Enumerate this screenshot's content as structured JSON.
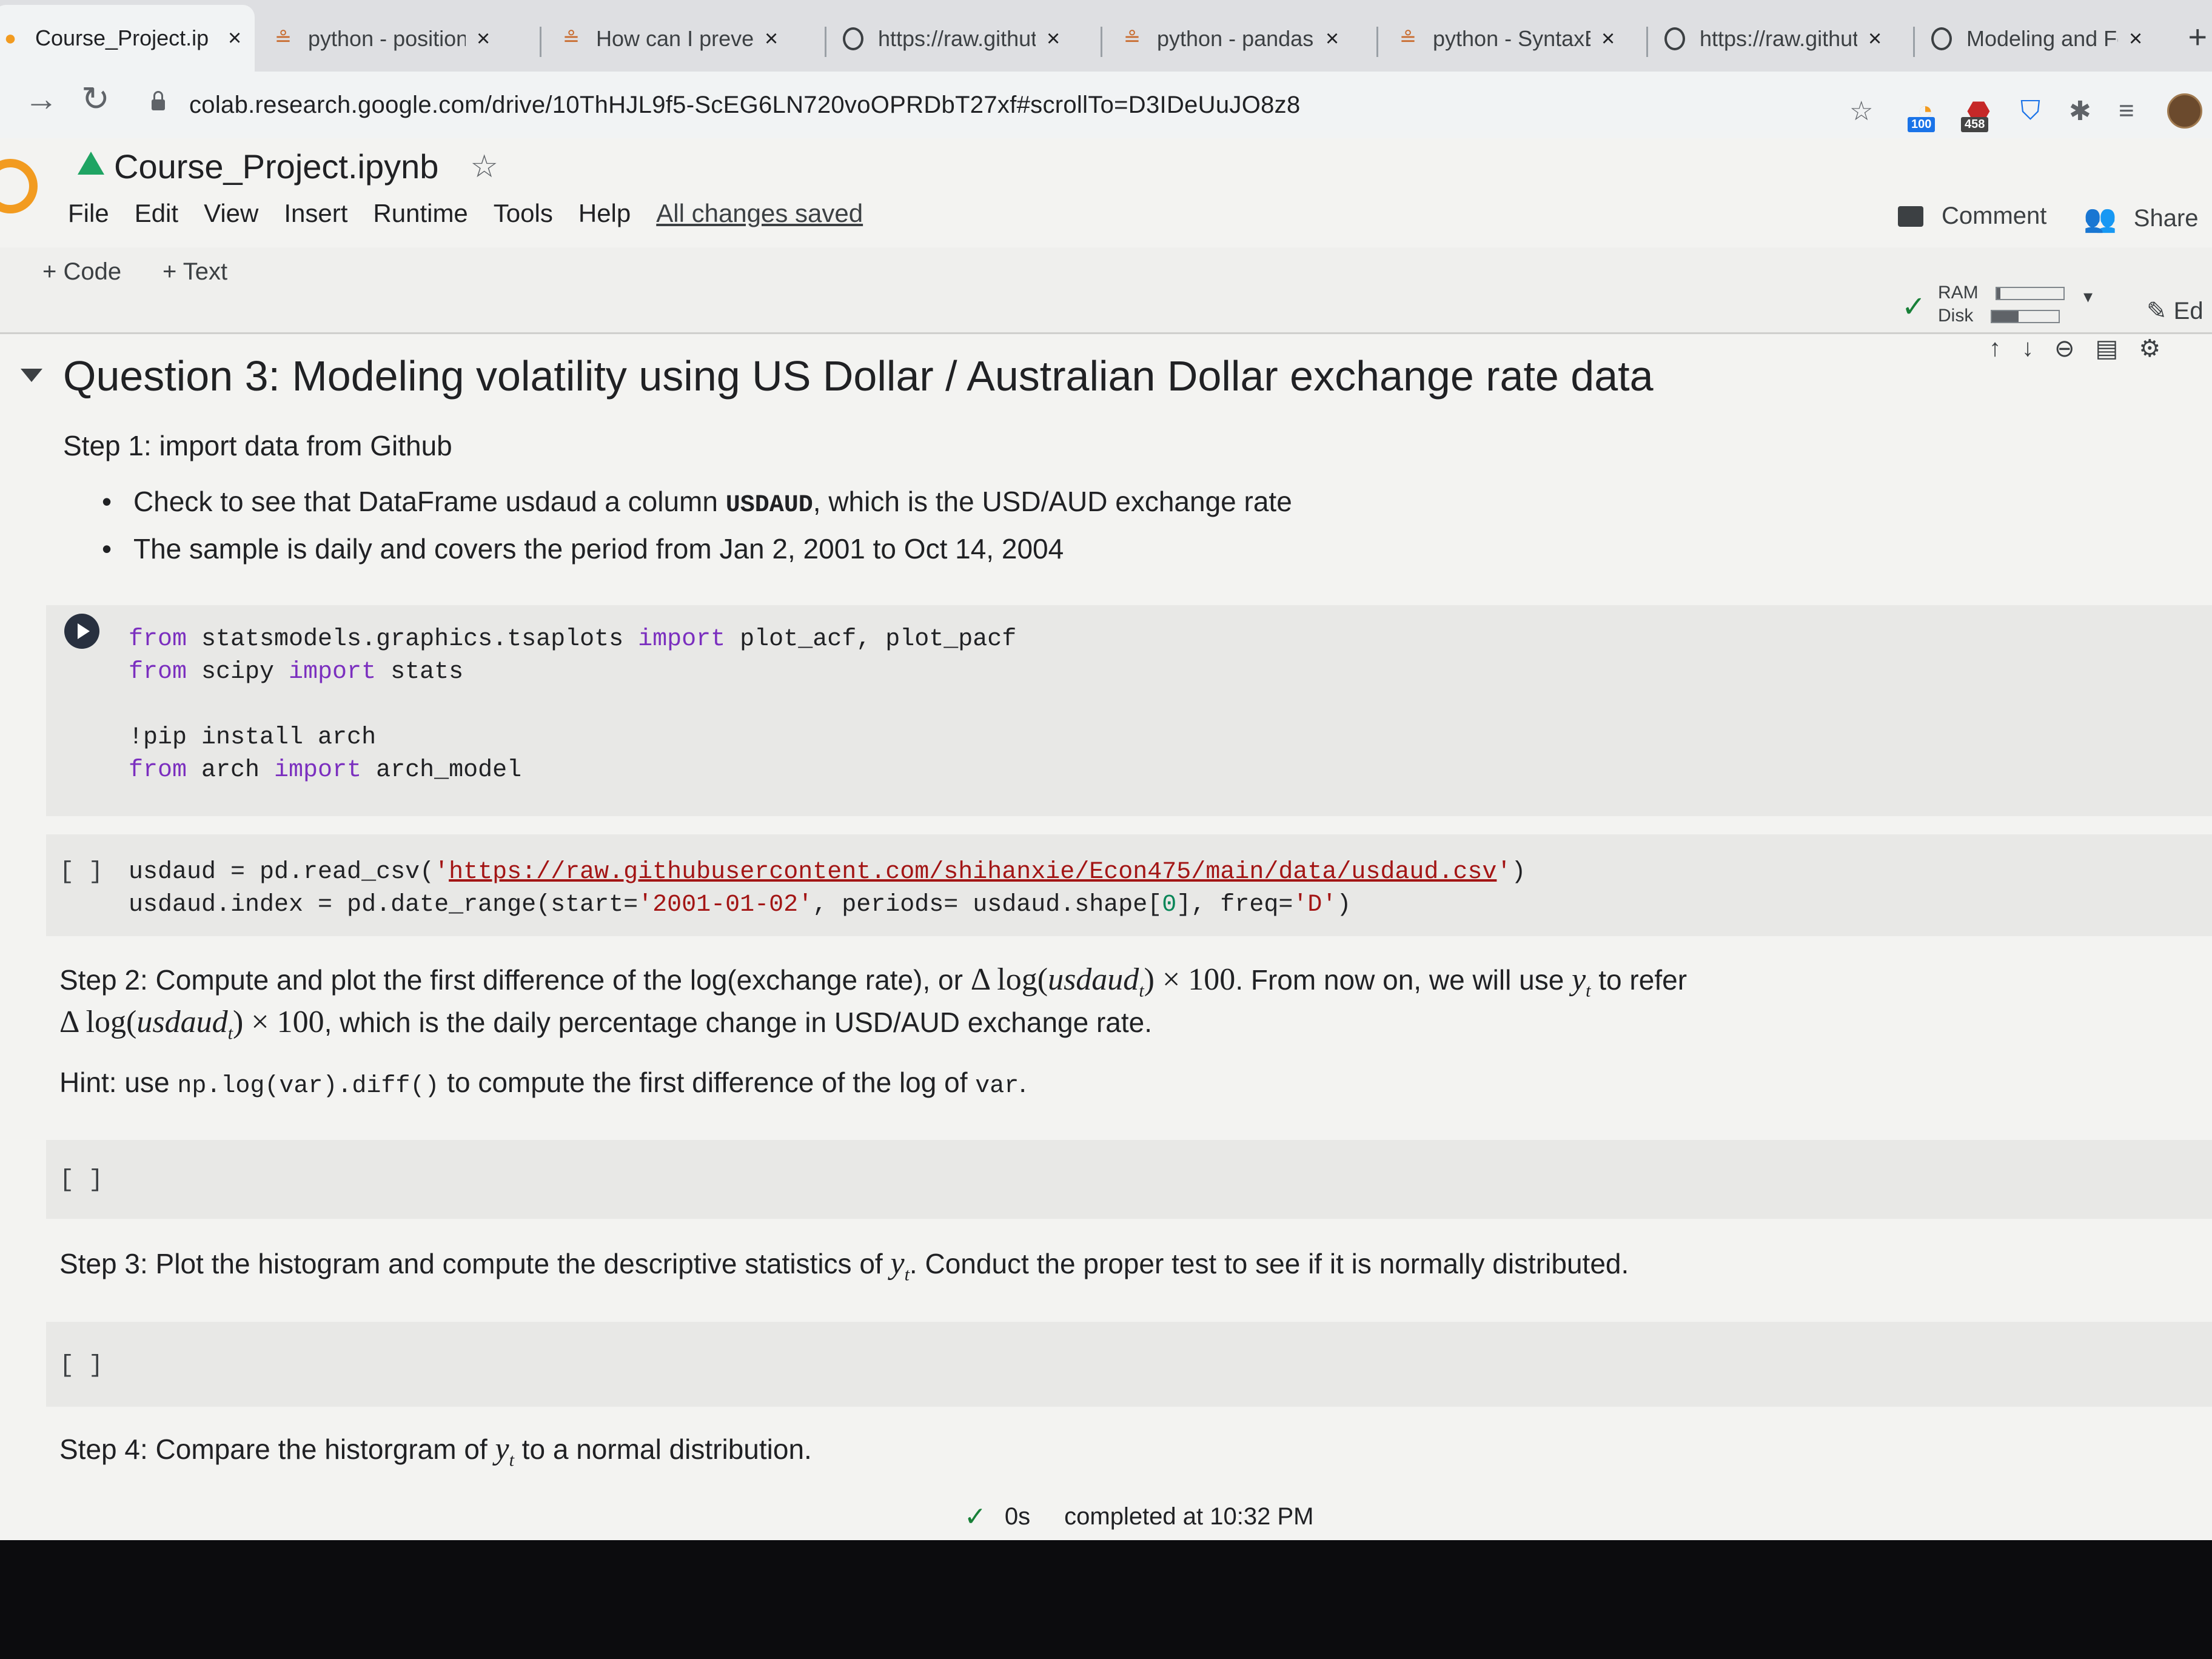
{
  "browser": {
    "tabs": [
      {
        "title": "Course_Project.ip",
        "icon": "colab-icon"
      },
      {
        "title": "python - position",
        "icon": "stackoverflow-icon"
      },
      {
        "title": "How can I preven",
        "icon": "stackoverflow-icon"
      },
      {
        "title": "https://raw.githut",
        "icon": "globe-icon"
      },
      {
        "title": "python - pandas",
        "icon": "stackoverflow-icon"
      },
      {
        "title": "python - SyntaxE",
        "icon": "stackoverflow-icon"
      },
      {
        "title": "https://raw.githut",
        "icon": "globe-icon"
      },
      {
        "title": "Modeling and Fo",
        "icon": "globe-icon"
      }
    ],
    "close_glyph": "×",
    "new_tab_glyph": "+",
    "url": "colab.research.google.com/drive/10ThHJL9f5-ScEG6LN720voOPRDbT27xf#scrollTo=D3IDeUuJO8z8",
    "extension_badges": {
      "rss": "100",
      "adblock": "458"
    }
  },
  "colab": {
    "notebook_title": "Course_Project.ipynb",
    "menu": [
      "File",
      "Edit",
      "View",
      "Insert",
      "Runtime",
      "Tools",
      "Help"
    ],
    "save_status": "All changes saved",
    "comment_label": "Comment",
    "share_label": "Share",
    "add_code_label": "+ Code",
    "add_text_label": "+ Text",
    "ram_label": "RAM",
    "disk_label": "Disk",
    "ram_usage": 0.05,
    "disk_usage": 0.4,
    "edit_label": "Ed"
  },
  "content": {
    "heading": "Question 3: Modeling volatility using US Dollar / Australian Dollar exchange rate data",
    "step1": "Step 1: import data from Github",
    "bullet1_pre": "Check to see that DataFrame usdaud a column ",
    "bullet1_code": "USDAUD",
    "bullet1_post": ", which is the USD/AUD exchange rate",
    "bullet2": "The sample is daily and covers the period from Jan 2, 2001 to Oct 14, 2004",
    "cell1": {
      "line1": [
        "from",
        " statsmodels.graphics.tsaplots ",
        "import",
        " plot_acf, plot_pacf"
      ],
      "line2": [
        "from",
        " scipy ",
        "import",
        " stats"
      ],
      "line3": "!pip install arch",
      "line4": [
        "from",
        " arch ",
        "import",
        " arch_model"
      ]
    },
    "cell2": {
      "bracket": "[ ]",
      "line1_a": "usdaud = pd.read_csv(",
      "line1_q1": "'",
      "line1_url": "https://raw.githubusercontent.com/shihanxie/Econ475/main/data/usdaud.csv",
      "line1_q2": "'",
      "line1_b": ")",
      "line2_a": "usdaud.index = pd.date_range(start=",
      "line2_s1": "'2001-01-02'",
      "line2_b": ", periods= usdaud.shape[",
      "line2_n": "0",
      "line2_c": "], freq=",
      "line2_s2": "'D'",
      "line2_d": ")"
    },
    "step2_a": "Step 2: Compute and plot the first difference of the log(exchange rate), or ",
    "step2_math1": "Δ log(",
    "step2_var": "usdaud",
    "step2_sub": "t",
    "step2_math2": ") × 100",
    "step2_b": ". From now on, we will use ",
    "step2_y": "y",
    "step2_ysub": "t",
    "step2_c": " to refer",
    "step2_line2_post": ", which is the daily percentage change in USD/AUD exchange rate.",
    "hint_a": "Hint: use ",
    "hint_code": "np.log(var).diff()",
    "hint_b": " to compute the first difference of the log of ",
    "hint_var": "var",
    "hint_c": ".",
    "empty_cell": "[ ]",
    "step3_a": "Step 3: Plot the histogram and compute the descriptive statistics of ",
    "step3_y": "y",
    "step3_sub": "t",
    "step3_b": ". Conduct the proper test to see if it is normally distributed.",
    "step4_a": "Step 4: Compare the historgram of ",
    "step4_y": "y",
    "step4_sub": "t",
    "step4_b": " to a normal distribution."
  },
  "statusbar": {
    "duration": "0s",
    "completed": "completed at 10:32 PM"
  }
}
